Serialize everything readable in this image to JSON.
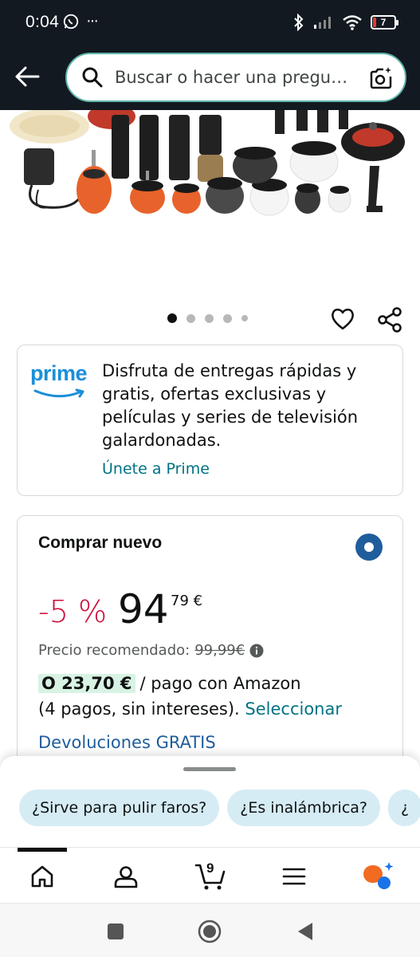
{
  "status_bar": {
    "time": "0:04",
    "more_dots": "···",
    "battery_level": "7"
  },
  "header": {
    "search_placeholder": "Buscar o hacer una pregu…"
  },
  "carousel": {
    "total": 5,
    "active_index": 0
  },
  "prime": {
    "logo_text": "prime",
    "description": "Disfruta de entregas rápidas y gratis, ofertas exclusivas y películas y series de televisión galardonadas.",
    "join_link": "Únete a Prime"
  },
  "buy_box": {
    "title": "Comprar nuevo",
    "discount": "-5 %",
    "price_whole": "94",
    "price_fraction": "79 €",
    "list_price_label": "Precio recomendado:",
    "list_price_value": "99,99€",
    "installment_amount": "O 23,70 €",
    "installment_suffix": "/ pago con Amazon",
    "installment_terms": "(4 pagos, sin intereses).",
    "installment_select": "Seleccionar",
    "returns": "Devoluciones GRATIS"
  },
  "questions": {
    "chips": [
      "¿Sirve para pulir faros?",
      "¿Es inalámbrica?",
      "¿"
    ]
  },
  "bottom_nav": {
    "cart_count": "9",
    "accent_colors": [
      "#f26b21",
      "#1a73e8"
    ]
  },
  "colors": {
    "header_bg": "#131921",
    "link": "#007185",
    "discount": "#cc0c39",
    "chip_bg": "#d6ecf5",
    "radio": "#1f5d9c"
  }
}
